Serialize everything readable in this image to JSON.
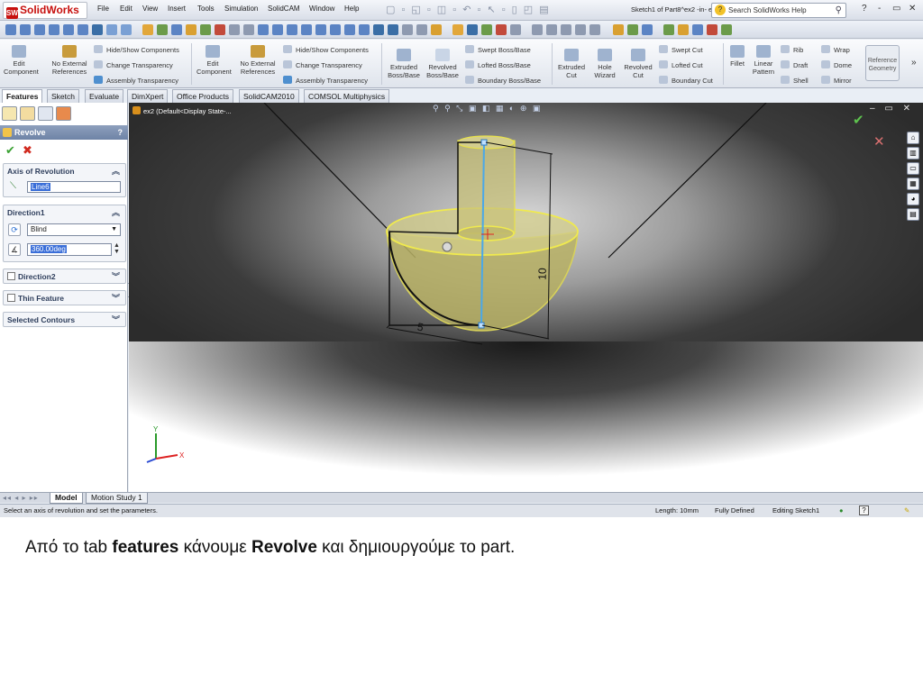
{
  "app": {
    "logo": "SolidWorks",
    "menu": [
      "File",
      "Edit",
      "View",
      "Insert",
      "Tools",
      "Simulation",
      "SolidCAM",
      "Window",
      "Help"
    ],
    "document_title": "Sketch1 of Part8^ex2 -in- ex...",
    "search_placeholder": "Search SolidWorks Help",
    "window_controls": [
      "?",
      "-",
      "▭",
      "✕"
    ]
  },
  "ribbon": {
    "assembly_group_1": {
      "edit_component": "Edit Component",
      "no_external_references": "No External References",
      "hide_show_components": "Hide/Show Components",
      "change_transparency": "Change Transparency",
      "assembly_transparency": "Assembly Transparency"
    },
    "assembly_group_2": {
      "edit_component": "Edit Component",
      "no_external_references": "No External References",
      "hide_show_components": "Hide/Show Components",
      "change_transparency": "Change Transparency",
      "assembly_transparency": "Assembly Transparency"
    },
    "boss_base": {
      "extruded": "Extruded Boss/Base",
      "revolved": "Revolved Boss/Base",
      "swept": "Swept Boss/Base",
      "lofted": "Lofted Boss/Base",
      "boundary": "Boundary Boss/Base"
    },
    "cut": {
      "extruded": "Extruded Cut",
      "hole_wizard": "Hole Wizard",
      "revolved": "Revolved Cut",
      "swept": "Swept Cut",
      "lofted": "Lofted Cut",
      "boundary": "Boundary Cut"
    },
    "features": {
      "fillet": "Fillet",
      "linear_pattern": "Linear Pattern",
      "rib": "Rib",
      "draft": "Draft",
      "shell": "Shell",
      "wrap": "Wrap",
      "dome": "Dome",
      "mirror": "Mirror",
      "reference_geometry": "Reference Geometry"
    },
    "more": "»"
  },
  "tabs": [
    "Features",
    "Sketch",
    "Evaluate",
    "DimXpert",
    "Office Products",
    "SolidCAM2010",
    "COMSOL Multiphysics"
  ],
  "active_tab": "Features",
  "property_manager": {
    "title": "Revolve",
    "help": "?",
    "ok_symbol": "✔",
    "cancel_symbol": "✖",
    "axis_group": {
      "label": "Axis of Revolution",
      "value": "Line6"
    },
    "direction1_group": {
      "label": "Direction1",
      "type": "Blind",
      "angle": "360.00deg"
    },
    "direction2_group": {
      "label": "Direction2"
    },
    "thin_feature_group": {
      "label": "Thin Feature"
    },
    "selected_contours_group": {
      "label": "Selected Contours"
    }
  },
  "viewport": {
    "tree_label": "ex2  (Default<Display State-...",
    "dimension_height": "10",
    "dimension_radius": "5",
    "triad": {
      "x": "X",
      "y": "Y"
    }
  },
  "bottom_tabs": [
    "Model",
    "Motion Study 1"
  ],
  "status": {
    "message": "Select an axis of revolution and set the parameters.",
    "length": "Length: 10mm",
    "defined": "Fully Defined",
    "editing": "Editing Sketch1"
  },
  "caption": {
    "pre": "Από το tab ",
    "bold1": "features",
    "mid": " κάνουμε ",
    "bold2": "Revolve",
    "post": " και δημιουργούμε το part."
  },
  "colors": {
    "accent_title": "#6e83a6",
    "ok": "#3aa133",
    "cancel": "#d12a1f",
    "axis_line": "#4aa8e8",
    "part_fill": "#c9c26a",
    "part_edge": "#e8e24a"
  }
}
